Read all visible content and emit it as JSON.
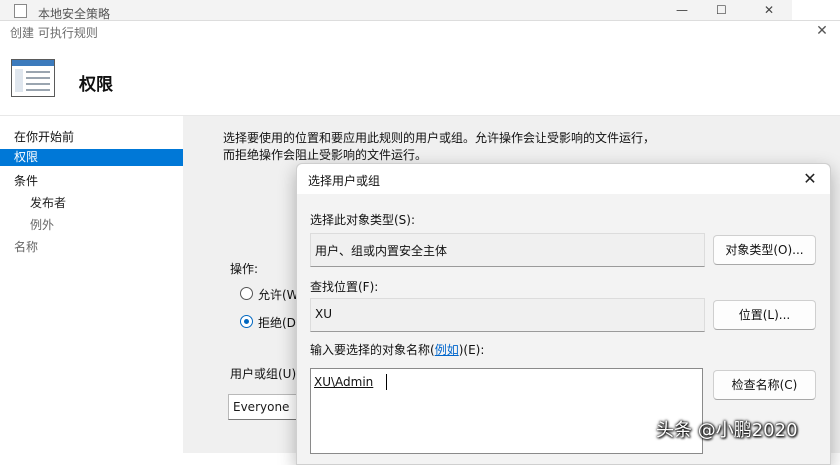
{
  "background_window": {
    "title": "本地安全策略",
    "minimize_glyph": "—",
    "maximize_glyph": "☐",
    "close_glyph": "✕"
  },
  "wizard": {
    "title": "创建 可执行规则",
    "close_glyph": "✕",
    "header_title": "权限",
    "nav": {
      "items": [
        {
          "label": "在你开始前"
        },
        {
          "label": "权限"
        },
        {
          "label": "条件"
        },
        {
          "label": "发布者"
        },
        {
          "label": "例外"
        },
        {
          "label": "名称"
        }
      ]
    },
    "description_line1": "选择要使用的位置和要应用此规则的用户或组。允许操作会让受影响的文件运行，",
    "description_line2": "而拒绝操作会阻止受影响的文件运行。",
    "action_label": "操作:",
    "allow_label": "允许(W",
    "deny_label": "拒绝(D)",
    "selected_action": "deny",
    "user_group_label": "用户或组(U):",
    "user_group_value": "Everyone"
  },
  "dialog": {
    "title": "选择用户或组",
    "close_glyph": "✕",
    "object_type_label": "选择此对象类型(S):",
    "object_type_value": "用户、组或内置安全主体",
    "object_types_button": "对象类型(O)...",
    "location_label": "查找位置(F):",
    "location_value": "XU",
    "locations_button": "位置(L)...",
    "enter_names_label_prefix": "输入要选择的对象名称(",
    "enter_names_link": "例如",
    "enter_names_label_suffix": ")(E):",
    "names_value": "XU\\Admin",
    "check_names_button": "检查名称(C)"
  },
  "watermark": "头条 @小鹏2020",
  "colors": {
    "accent": "#0078d7",
    "link": "#0066cc",
    "panel_bg": "#f0f0f0"
  }
}
